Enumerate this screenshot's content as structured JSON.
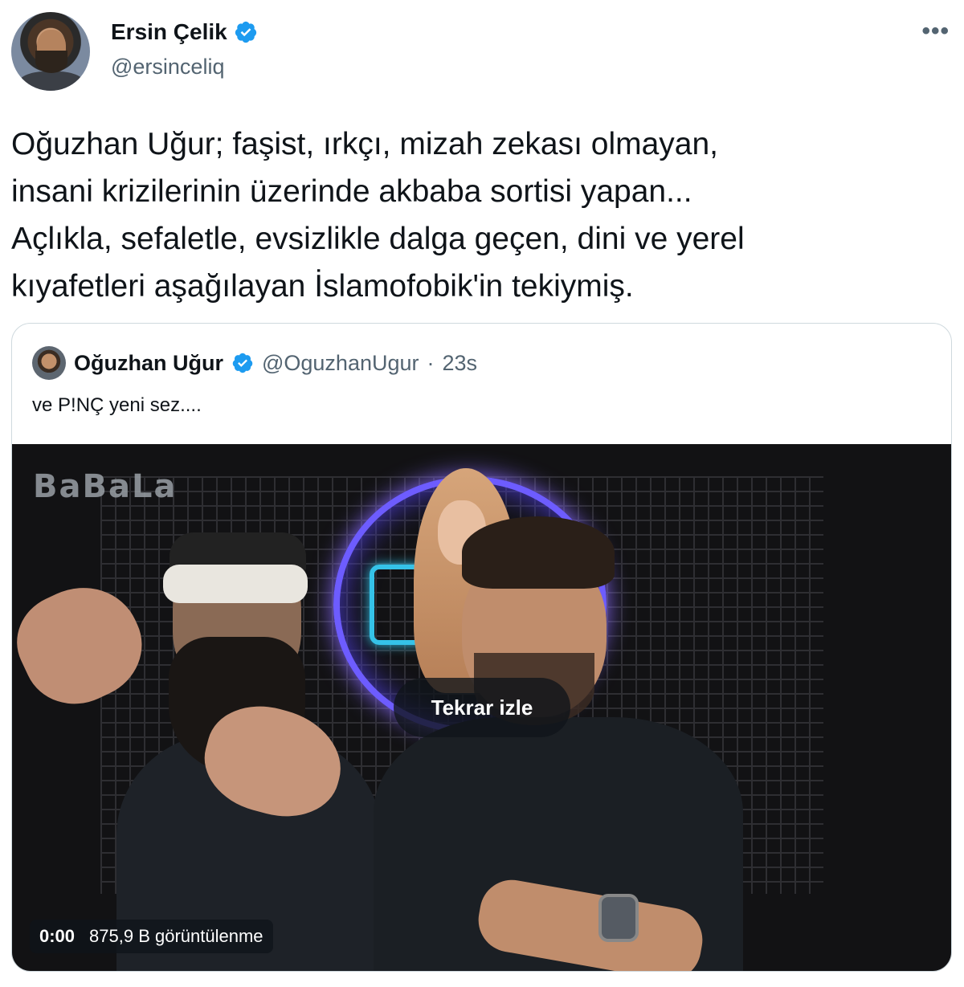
{
  "author": {
    "display_name": "Ersin Çelik",
    "handle": "@ersinceliq",
    "verified": true
  },
  "more_icon": "more-horizontal-icon",
  "tweet": {
    "lines": [
      "Oğuzhan Uğur; faşist, ırkçı, mizah zekası olmayan,",
      "insani krizilerinin üzerinde akbaba sortisi yapan...",
      "Açlıkla, sefaletle, evsizlikle dalga geçen, dini ve yerel",
      "kıyafetleri aşağılayan İslamofobik'in tekiymiş."
    ]
  },
  "quote": {
    "display_name": "Oğuzhan Uğur",
    "handle": "@OguzhanUgur",
    "separator": "·",
    "time": "23s",
    "text": "ve P!NÇ yeni sez....",
    "media": {
      "brand_watermark": "BaBaLa",
      "replay_label": "Tekrar izle",
      "current_time": "0:00",
      "views": "875,9 B görüntülenme"
    }
  },
  "colors": {
    "text_primary": "#0f1419",
    "text_secondary": "#536471",
    "verified_blue": "#1d9bf0",
    "border": "#cfd9de"
  }
}
